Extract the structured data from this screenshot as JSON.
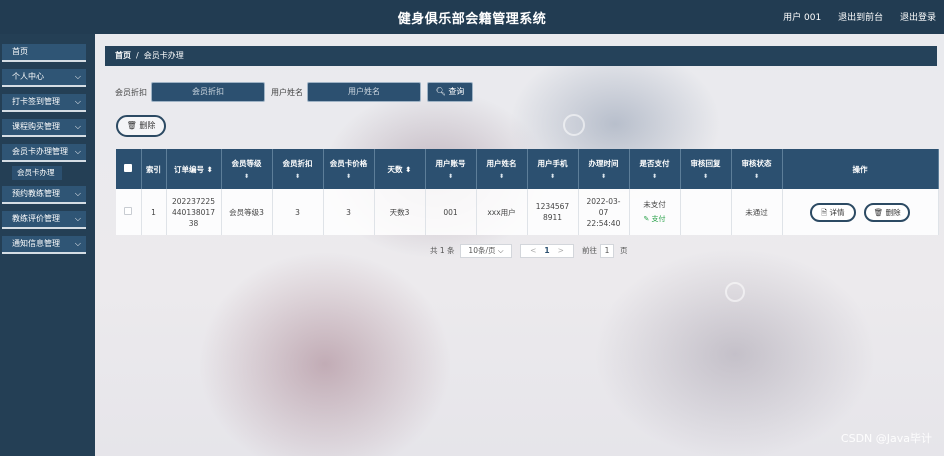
{
  "app": {
    "title": "健身俱乐部会籍管理系统"
  },
  "topbar": {
    "user": "用户 001",
    "front": "退出到前台",
    "logout": "退出登录"
  },
  "sidebar": {
    "items": [
      {
        "label": "首页",
        "has_chevron": false
      },
      {
        "label": "个人中心",
        "has_chevron": true
      },
      {
        "label": "打卡签到管理",
        "has_chevron": true
      },
      {
        "label": "课程购买管理",
        "has_chevron": true
      },
      {
        "label": "会员卡办理管理",
        "has_chevron": true,
        "sub": "会员卡办理"
      },
      {
        "label": "预约教练管理",
        "has_chevron": true
      },
      {
        "label": "教练评价管理",
        "has_chevron": true
      },
      {
        "label": "通知信息管理",
        "has_chevron": true
      }
    ]
  },
  "breadcrumb": {
    "home": "首页",
    "sep": "/",
    "current": "会员卡办理"
  },
  "search": {
    "discount_label": "会员折扣",
    "discount_placeholder": "会员折扣",
    "name_label": "用户姓名",
    "name_placeholder": "用户姓名",
    "query_button": "查询"
  },
  "actions": {
    "delete": "删除"
  },
  "table": {
    "headers": [
      "索引",
      "订单编号",
      "会员等级",
      "会员折扣",
      "会员卡价格",
      "天数",
      "用户账号",
      "用户姓名",
      "用户手机",
      "办理时间",
      "是否支付",
      "审核回复",
      "审核状态",
      "操作"
    ],
    "rows": [
      {
        "index": "1",
        "order_no": "20223722544013801738",
        "level": "会员等级3",
        "discount": "3",
        "price": "3",
        "days": "天数3",
        "account": "001",
        "name": "xxx用户",
        "phone": "12345678911",
        "time": "2022-03-07 22:54:40",
        "paid": "未支付",
        "pay_btn": "支付",
        "reply": "",
        "status": "未通过",
        "detail_btn": "详情",
        "delete_btn": "删除"
      }
    ]
  },
  "pager": {
    "total": "共 1 条",
    "page_size": "10条/页",
    "prev": "<",
    "current": "1",
    "next": ">",
    "goto": "前往",
    "goto_value": "1",
    "page_unit": "页"
  },
  "watermark": "CSDN @Java毕计"
}
